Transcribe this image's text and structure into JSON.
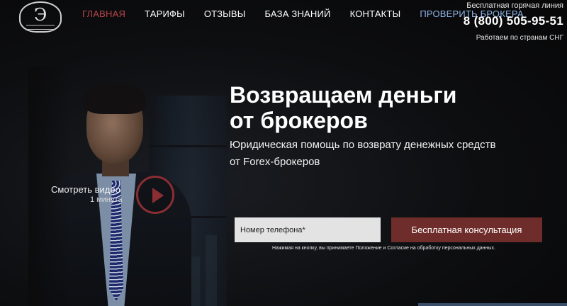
{
  "header": {
    "logo": {
      "letter": "Э",
      "icon": "crest-logo-icon"
    },
    "nav": [
      {
        "label": "ГЛАВНАЯ",
        "state": "active"
      },
      {
        "label": "ТАРИФЫ"
      },
      {
        "label": "ОТЗЫВЫ"
      },
      {
        "label": "БАЗА ЗНАНИЙ"
      },
      {
        "label": "КОНТАКТЫ"
      },
      {
        "label": "ПРОВЕРИТЬ БРОКЕРА",
        "state": "accent"
      }
    ],
    "contact": {
      "hotline_label": "Бесплатная горячая линия",
      "phone": "8 (800) 505-95-51",
      "region": "Работаем по странам СНГ"
    }
  },
  "hero": {
    "headline_line1": "Возвращаем деньги",
    "headline_line2": "от брокеров",
    "subtitle_line1": "Юридическая помощь по возврату денежных средств",
    "subtitle_line2": "от Forex-брокеров"
  },
  "video": {
    "label": "Смотреть видео",
    "duration": "1 минута",
    "icon": "play-icon"
  },
  "form": {
    "phone_placeholder": "Номер телефона*",
    "phone_value": "",
    "submit_label": "Бесплатная консультация",
    "disclaimer": "Нажимая на кнопку, вы принимаете Положение и Согласие на обработку персональных данных."
  },
  "colors": {
    "background": "#0b0b0c",
    "nav_active": "#b8454a",
    "nav_accent": "#8fb3e6",
    "cta": "#6e2d2b",
    "play_ring": "#8a2e34"
  }
}
